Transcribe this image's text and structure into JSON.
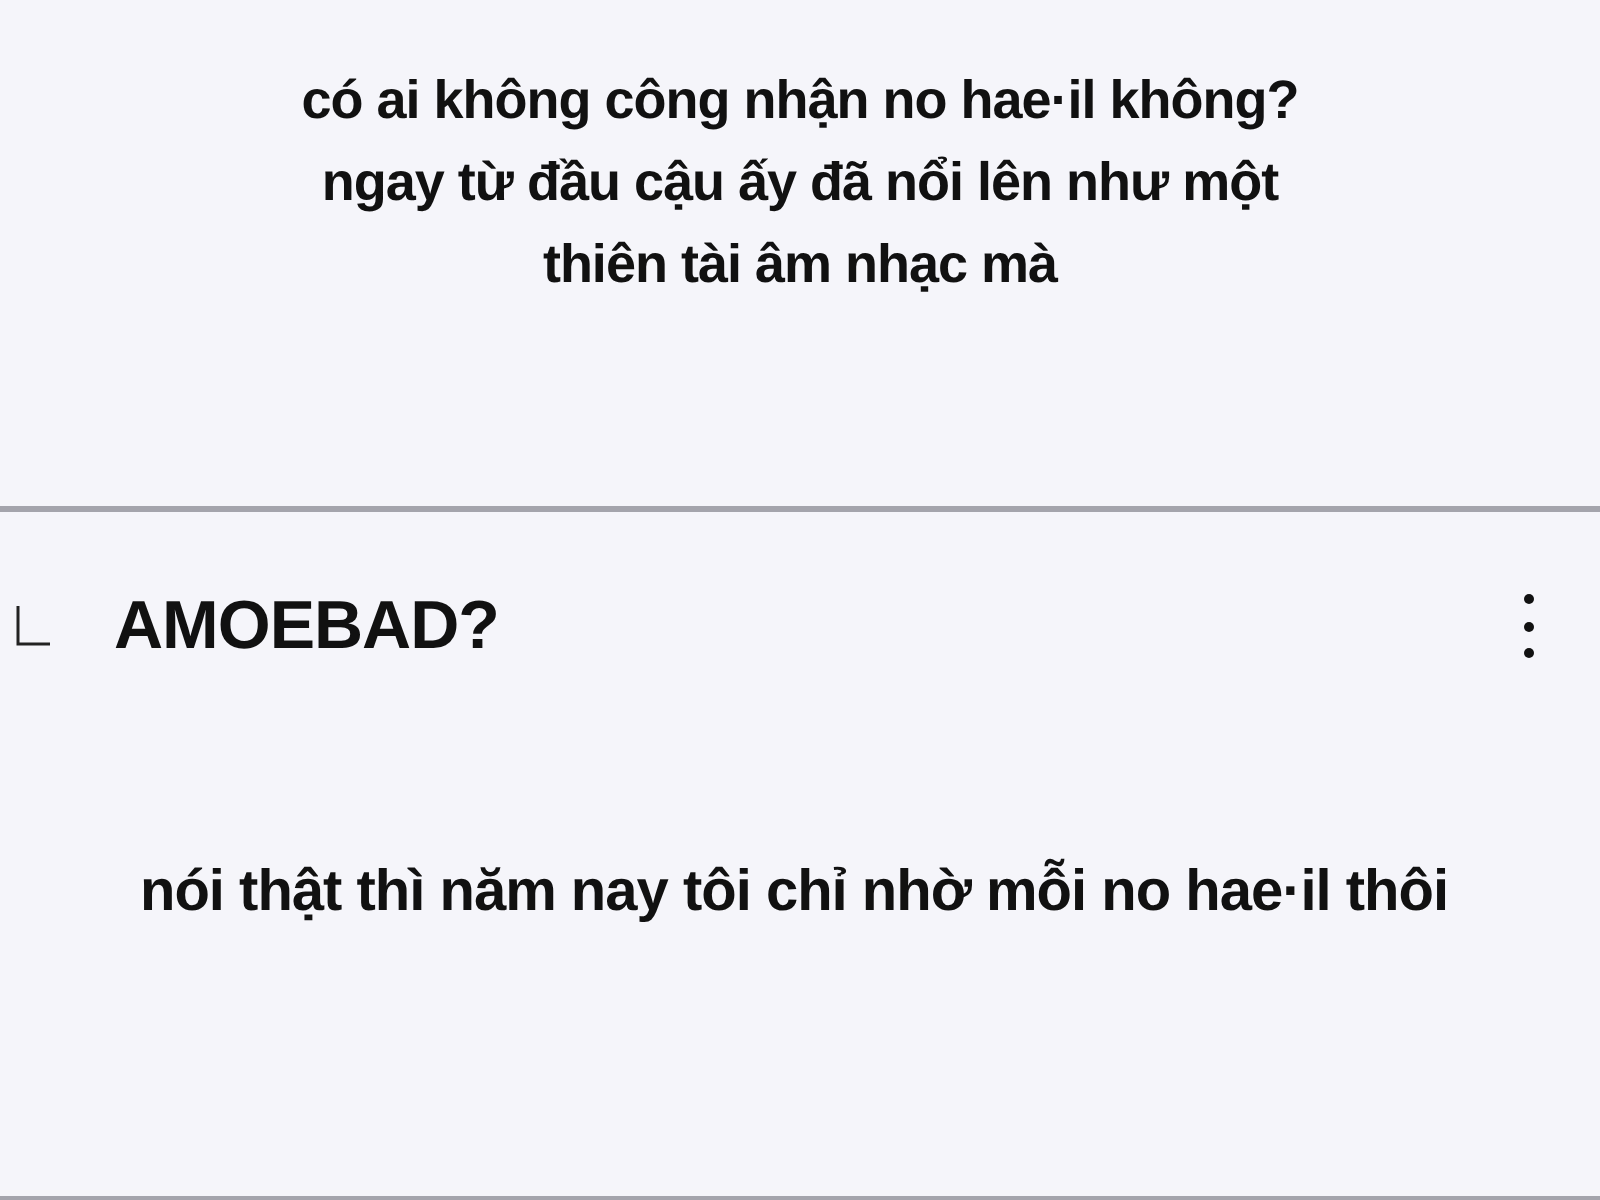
{
  "post": {
    "lines": [
      "có ai không công nhận no hae·il không?",
      "ngay từ đầu cậu ấy đã nổi lên như một",
      "thiên tài âm nhạc mà"
    ]
  },
  "reply": {
    "author": "AMOEBAD?",
    "text": "nói thật thì năm nay tôi chỉ nhờ mỗi no hae·il thôi"
  }
}
